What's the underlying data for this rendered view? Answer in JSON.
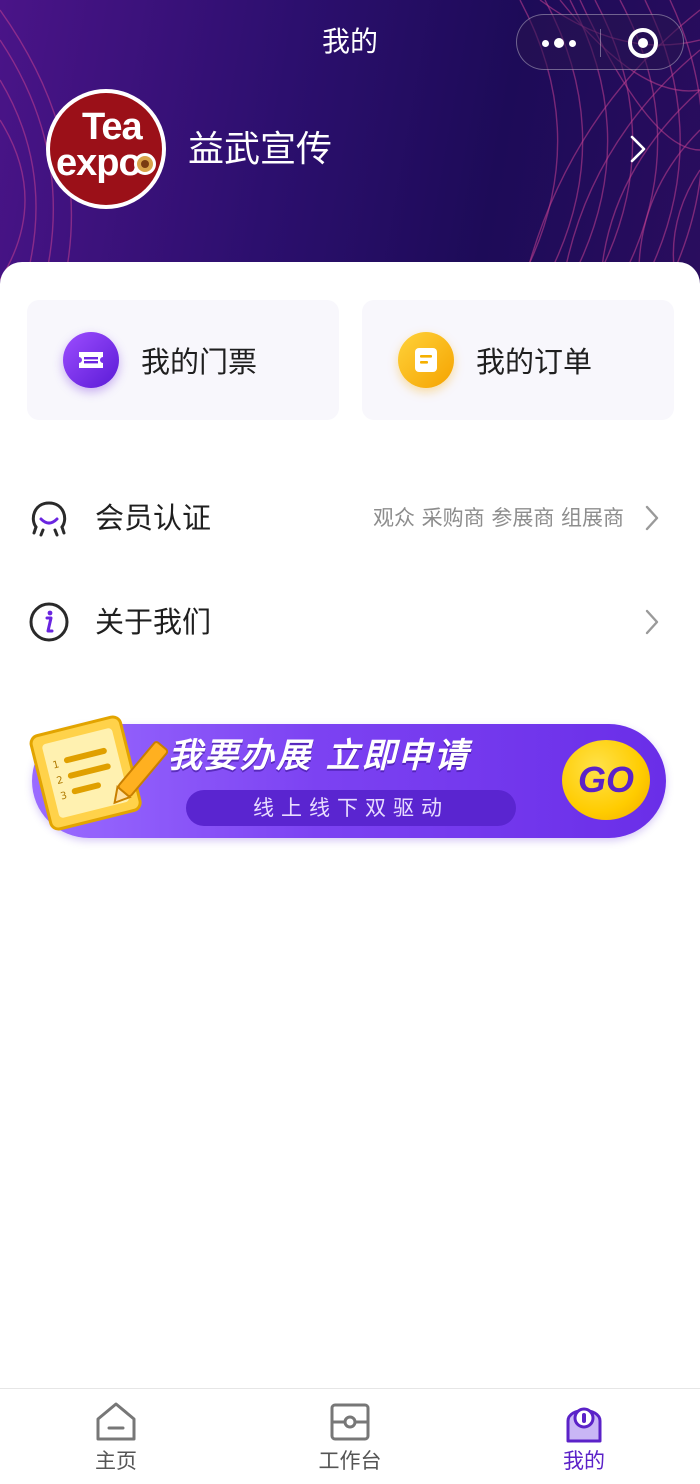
{
  "nav": {
    "title": "我的",
    "more_icon": "more-dots-icon",
    "close_icon": "target-close-icon"
  },
  "profile": {
    "name": "益武宣传",
    "avatar_logo_text_line1": "Tea",
    "avatar_logo_text_line2": "expo",
    "arrow_icon": "chevron-right-icon"
  },
  "shortcuts": [
    {
      "label": "我的门票",
      "icon": "ticket-icon",
      "color": "#7b2ff0"
    },
    {
      "label": "我的订单",
      "icon": "order-icon",
      "color": "#ffc21a"
    }
  ],
  "menu": [
    {
      "label": "会员认证",
      "tags": "观众 采购商 参展商 组展商",
      "icon": "member-icon"
    },
    {
      "label": "关于我们",
      "tags": "",
      "icon": "info-icon"
    }
  ],
  "banner": {
    "headline": "我要办展 立即申请",
    "subtitle": "线上线下双驱动",
    "go_label": "GO",
    "icon": "notepad-pencil-icon"
  },
  "tabbar": [
    {
      "label": "主页",
      "icon": "home-icon",
      "active": false
    },
    {
      "label": "工作台",
      "icon": "workbench-icon",
      "active": false
    },
    {
      "label": "我的",
      "icon": "user-icon",
      "active": true
    }
  ],
  "colors": {
    "header_bg": "#2c0f6e",
    "accent": "#5b22c8",
    "banner_bg": "#7c42f2",
    "go_yellow": "#ffcc00"
  }
}
